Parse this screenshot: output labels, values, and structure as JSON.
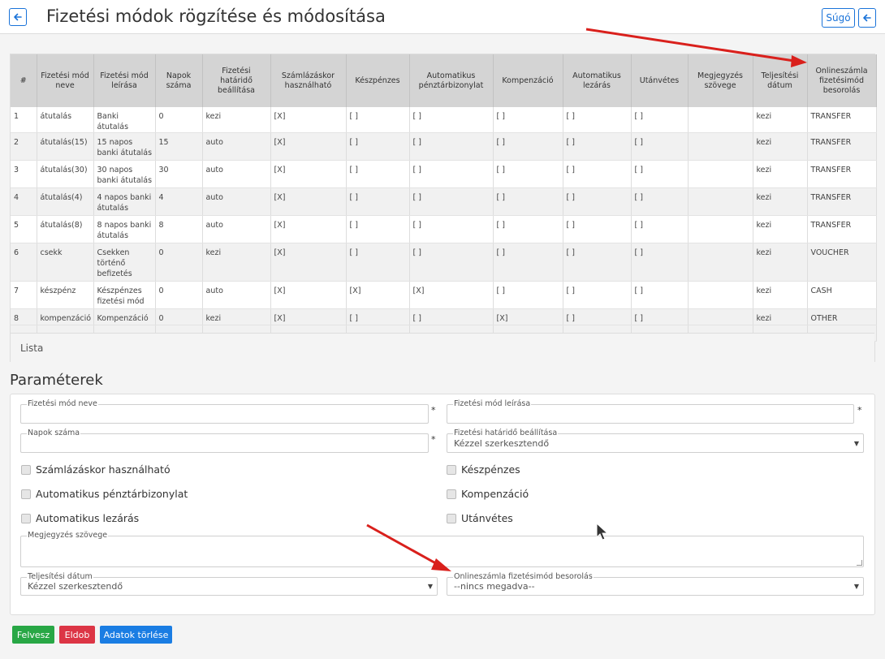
{
  "header": {
    "title": "Fizetési módok rögzítése és módosítása",
    "help_label": "Súgó"
  },
  "table": {
    "columns": [
      "#",
      "Fizetési mód neve",
      "Fizetési mód leírása",
      "Napok száma",
      "Fizetési határidő beállítása",
      "Számlázáskor használható",
      "Készpénzes",
      "Automatikus pénztárbizonylat",
      "Kompenzáció",
      "Automatikus lezárás",
      "Utánvétes",
      "Megjegyzés szövege",
      "Teljesítési dátum",
      "Onlineszámla fizetésimód besorolás"
    ],
    "rows": [
      [
        "1",
        "átutalás",
        "Banki átutalás",
        "0",
        "kezi",
        "[X]",
        "[ ]",
        "[ ]",
        "[ ]",
        "[ ]",
        "[ ]",
        "",
        "kezi",
        "TRANSFER"
      ],
      [
        "2",
        "átutalás(15)",
        "15 napos banki átutalás",
        "15",
        "auto",
        "[X]",
        "[ ]",
        "[ ]",
        "[ ]",
        "[ ]",
        "[ ]",
        "",
        "kezi",
        "TRANSFER"
      ],
      [
        "3",
        "átutalás(30)",
        "30 napos banki átutalás",
        "30",
        "auto",
        "[X]",
        "[ ]",
        "[ ]",
        "[ ]",
        "[ ]",
        "[ ]",
        "",
        "kezi",
        "TRANSFER"
      ],
      [
        "4",
        "átutalás(4)",
        "4 napos banki átutalás",
        "4",
        "auto",
        "[X]",
        "[ ]",
        "[ ]",
        "[ ]",
        "[ ]",
        "[ ]",
        "",
        "kezi",
        "TRANSFER"
      ],
      [
        "5",
        "átutalás(8)",
        "8 napos banki átutalás",
        "8",
        "auto",
        "[X]",
        "[ ]",
        "[ ]",
        "[ ]",
        "[ ]",
        "[ ]",
        "",
        "kezi",
        "TRANSFER"
      ],
      [
        "6",
        "csekk",
        "Csekken történő befizetés",
        "0",
        "kezi",
        "[X]",
        "[ ]",
        "[ ]",
        "[ ]",
        "[ ]",
        "[ ]",
        "",
        "kezi",
        "VOUCHER"
      ],
      [
        "7",
        "készpénz",
        "Készpénzes fizetési mód",
        "0",
        "auto",
        "[X]",
        "[X]",
        "[X]",
        "[ ]",
        "[ ]",
        "[ ]",
        "",
        "kezi",
        "CASH"
      ],
      [
        "8",
        "kompenzáció",
        "Kompenzáció",
        "0",
        "kezi",
        "[X]",
        "[ ]",
        "[ ]",
        "[X]",
        "[ ]",
        "[ ]",
        "",
        "kezi",
        "OTHER"
      ]
    ],
    "footer_label": "Lista"
  },
  "params": {
    "title": "Paraméterek",
    "name_label": "Fizetési mód neve",
    "name_value": "",
    "desc_label": "Fizetési mód leírása",
    "desc_value": "",
    "days_label": "Napok száma",
    "days_value": "",
    "deadline_label": "Fizetési határidő beállítása",
    "deadline_value": "Kézzel szerkesztendő",
    "required_mark": "*",
    "checkboxes": [
      {
        "label": "Számlázáskor használható",
        "checked": false
      },
      {
        "label": "Készpénzes",
        "checked": false
      },
      {
        "label": "Automatikus pénztárbizonylat",
        "checked": false
      },
      {
        "label": "Kompenzáció",
        "checked": false
      },
      {
        "label": "Automatikus lezárás",
        "checked": false
      },
      {
        "label": "Utánvétes",
        "checked": false
      }
    ],
    "note_label": "Megjegyzés szövege",
    "note_value": "",
    "date_label": "Teljesítési dátum",
    "date_value": "Kézzel szerkesztendő",
    "online_label": "Onlineszámla fizetésimód besorolás",
    "online_value": "--nincs megadva--"
  },
  "buttons": {
    "add": "Felvesz",
    "delete": "Eldob",
    "clear": "Adatok törlése"
  },
  "colors": {
    "accent": "#1a73d9",
    "add": "#28a745",
    "delete": "#dc3545",
    "clear": "#1a7de3",
    "annotation_arrow": "#d9201c"
  },
  "icons": [
    "arrow-left-icon",
    "arrow-left-icon",
    "mouse-cursor-icon",
    "annotation-arrow-icon"
  ]
}
